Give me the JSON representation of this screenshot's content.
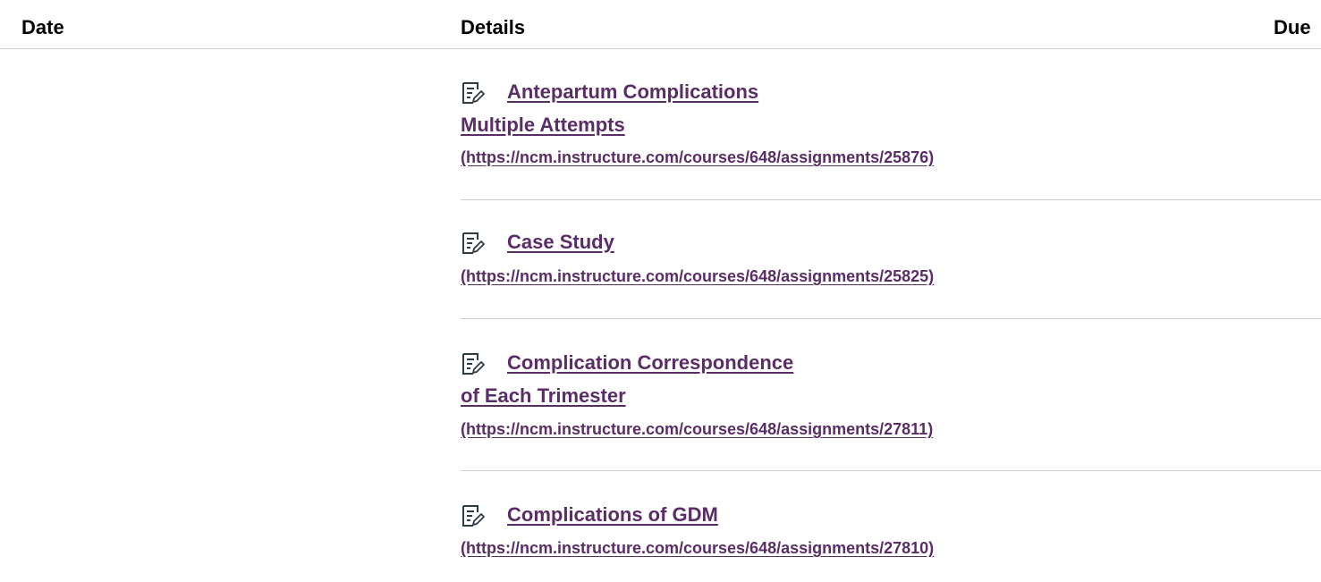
{
  "columns": {
    "date": "Date",
    "details": "Details",
    "due": "Due"
  },
  "assignments": [
    {
      "icon": "assignment-icon",
      "title_lines": [
        "Antepartum Complications",
        "Multiple Attempts"
      ],
      "url": "(https://ncm.instructure.com/courses/648/assignments/25876)"
    },
    {
      "icon": "assignment-icon",
      "title_lines": [
        "Case Study"
      ],
      "url": "(https://ncm.instructure.com/courses/648/assignments/25825)"
    },
    {
      "icon": "assignment-icon",
      "title_lines": [
        "Complication Correspondence",
        "of Each Trimester"
      ],
      "url": "(https://ncm.instructure.com/courses/648/assignments/27811)"
    },
    {
      "icon": "assignment-icon",
      "title_lines": [
        "Complications of GDM"
      ],
      "url": "(https://ncm.instructure.com/courses/648/assignments/27810)"
    }
  ],
  "colors": {
    "link": "#5a2d66",
    "divider": "#c7cdd1",
    "header_text": "#000000"
  }
}
